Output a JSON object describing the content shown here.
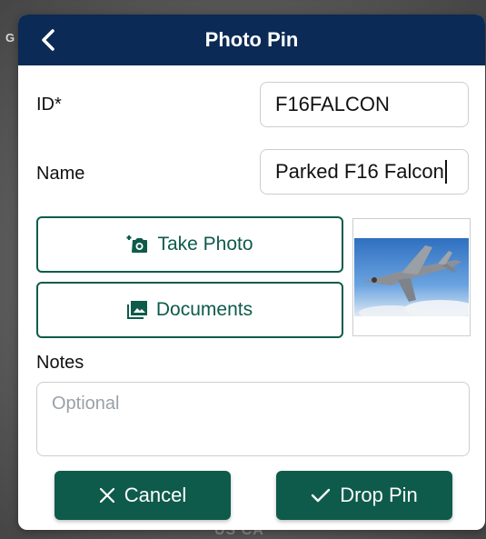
{
  "background": {
    "map_left_label": "G",
    "map_bottom_label": "US CA"
  },
  "header": {
    "title": "Photo Pin",
    "back_icon": "chevron-left-icon",
    "bg_color": "#0b2a55"
  },
  "form": {
    "id_label": "ID*",
    "id_value": "F16FALCON",
    "name_label": "Name",
    "name_value": "Parked F16 Falcon",
    "notes_label": "Notes",
    "notes_placeholder": "Optional"
  },
  "actions": {
    "take_photo_label": "Take Photo",
    "take_photo_icon": "add-camera-icon",
    "documents_label": "Documents",
    "documents_icon": "image-stack-icon",
    "thumbnail_icon": "jet-photo-thumbnail"
  },
  "footer": {
    "cancel_label": "Cancel",
    "cancel_icon": "close-icon",
    "drop_label": "Drop Pin",
    "drop_icon": "check-icon",
    "button_color": "#0e5b4b"
  }
}
